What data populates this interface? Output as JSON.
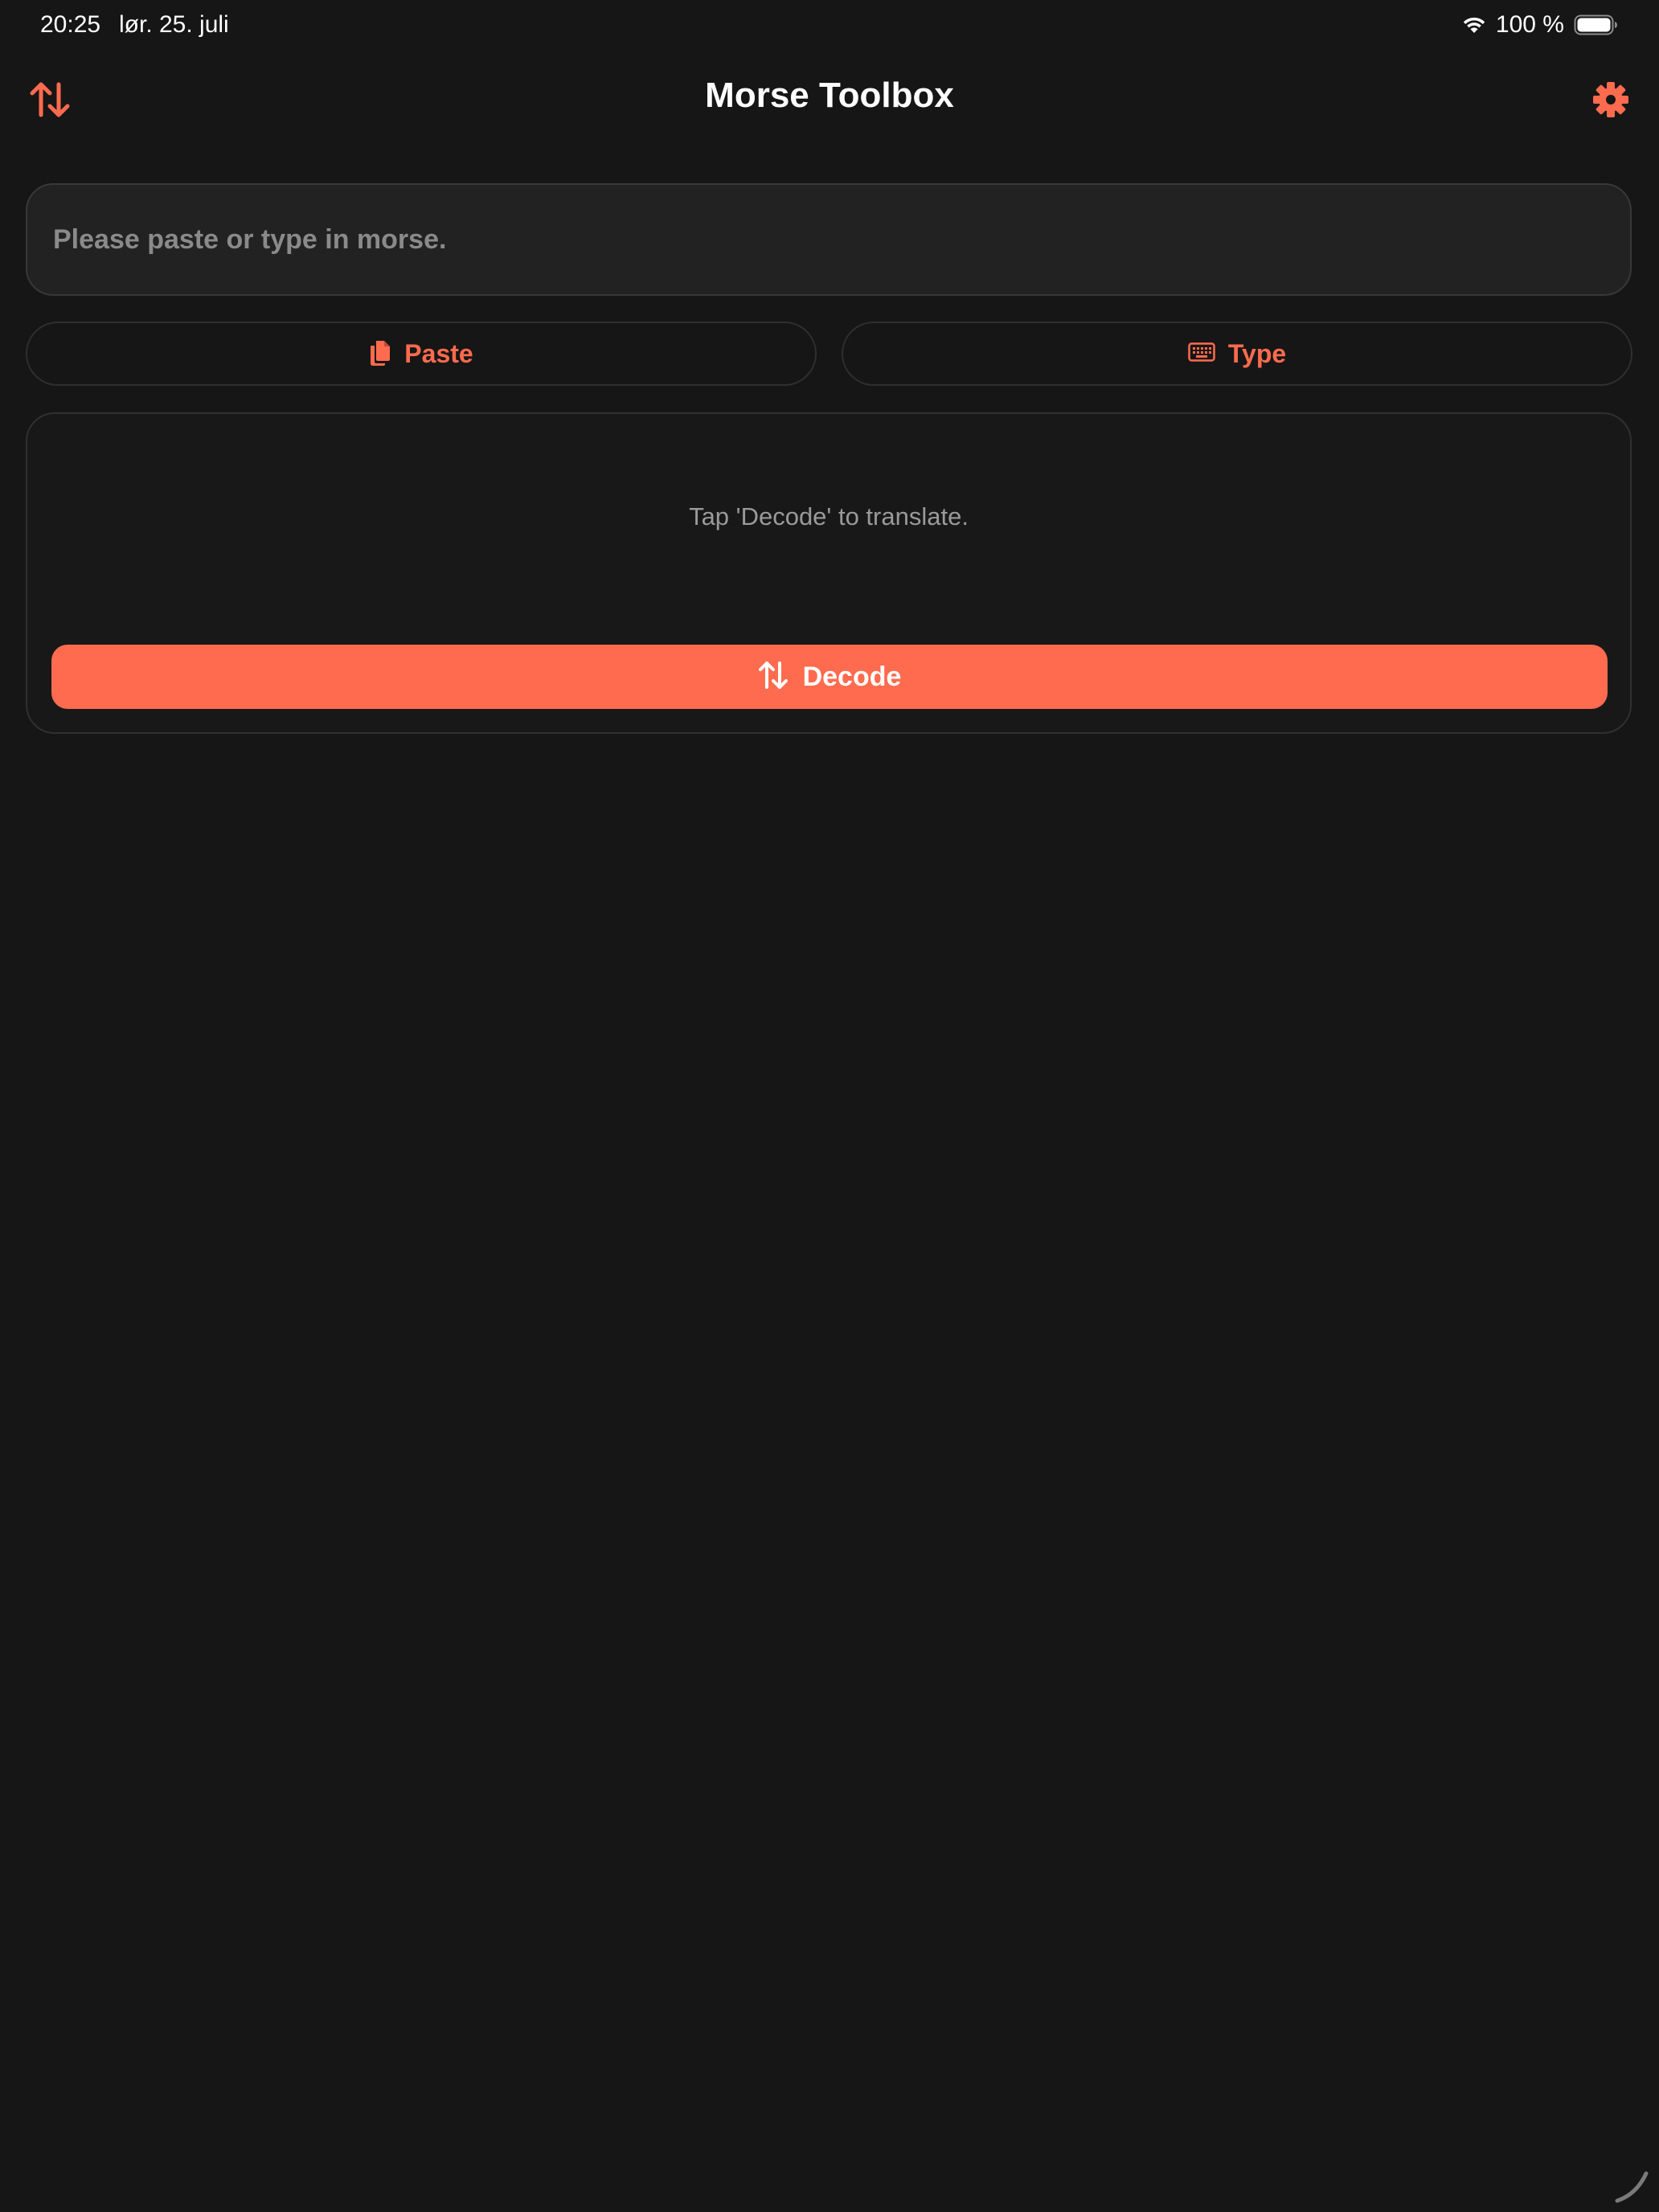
{
  "status_bar": {
    "time": "20:25",
    "date": "lør. 25. juli",
    "battery": "100 %",
    "wifi_icon": "wifi-icon",
    "battery_icon": "battery-icon"
  },
  "nav": {
    "title": "Morse Toolbox",
    "left_icon": "swap-arrows-icon",
    "right_icon": "gear-icon"
  },
  "input": {
    "value": "",
    "placeholder": "Please paste or type in morse."
  },
  "actions": {
    "paste_label": "Paste",
    "paste_icon": "clipboard-icon",
    "type_label": "Type",
    "type_icon": "keyboard-icon"
  },
  "result": {
    "hint": "Tap 'Decode' to translate.",
    "decode_label": "Decode",
    "decode_icon": "swap-arrows-icon"
  },
  "colors": {
    "background": "#161616",
    "accent": "#ff6b4e",
    "text_primary": "#ffffff",
    "text_secondary": "#9a9a9a"
  }
}
